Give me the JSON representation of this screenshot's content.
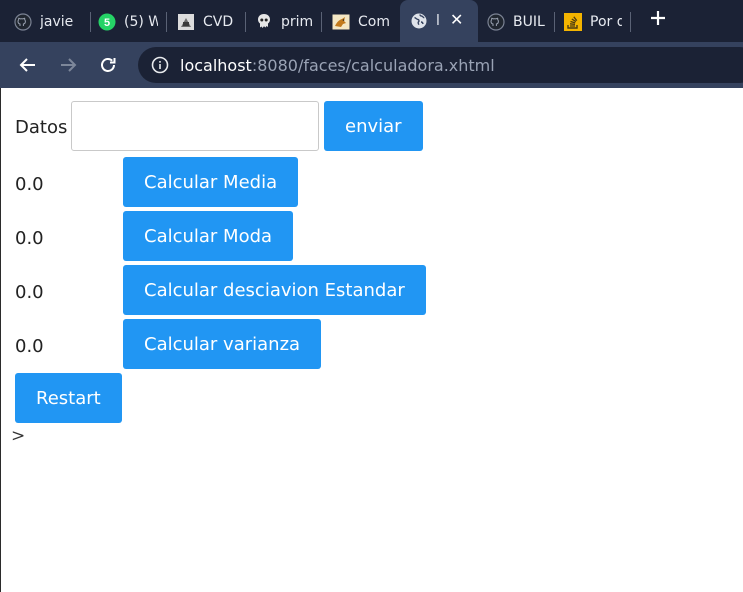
{
  "browser": {
    "tabs": [
      {
        "title": "javie",
        "icon": "github-icon"
      },
      {
        "title": "(5) W",
        "icon": "whatsapp-icon"
      },
      {
        "title": "CVD",
        "icon": "page-icon"
      },
      {
        "title": "prim",
        "icon": "primefaces-icon"
      },
      {
        "title": "Com",
        "icon": "tomcat-icon"
      },
      {
        "title": "l",
        "icon": "globe-icon",
        "active": true
      },
      {
        "title": "BUIL",
        "icon": "github-icon"
      },
      {
        "title": "Por q",
        "icon": "stackoverflow-icon"
      }
    ],
    "whatsapp_badge": "5",
    "url_host": "localhost",
    "url_path": ":8080/faces/calculadora.xhtml"
  },
  "form": {
    "datos_label": "Datos",
    "datos_value": "",
    "enviar_label": "enviar",
    "rows": [
      {
        "value": "0.0",
        "button": "Calcular Media"
      },
      {
        "value": "0.0",
        "button": "Calcular Moda"
      },
      {
        "value": "0.0",
        "button": "Calcular desciavion Estandar"
      },
      {
        "value": "0.0",
        "button": "Calcular varianza"
      }
    ],
    "restart_label": "Restart",
    "stray_text": ">"
  },
  "colors": {
    "button_bg": "#2196f3",
    "tabstrip_bg": "#1b2235",
    "toolbar_bg": "#35425e"
  }
}
